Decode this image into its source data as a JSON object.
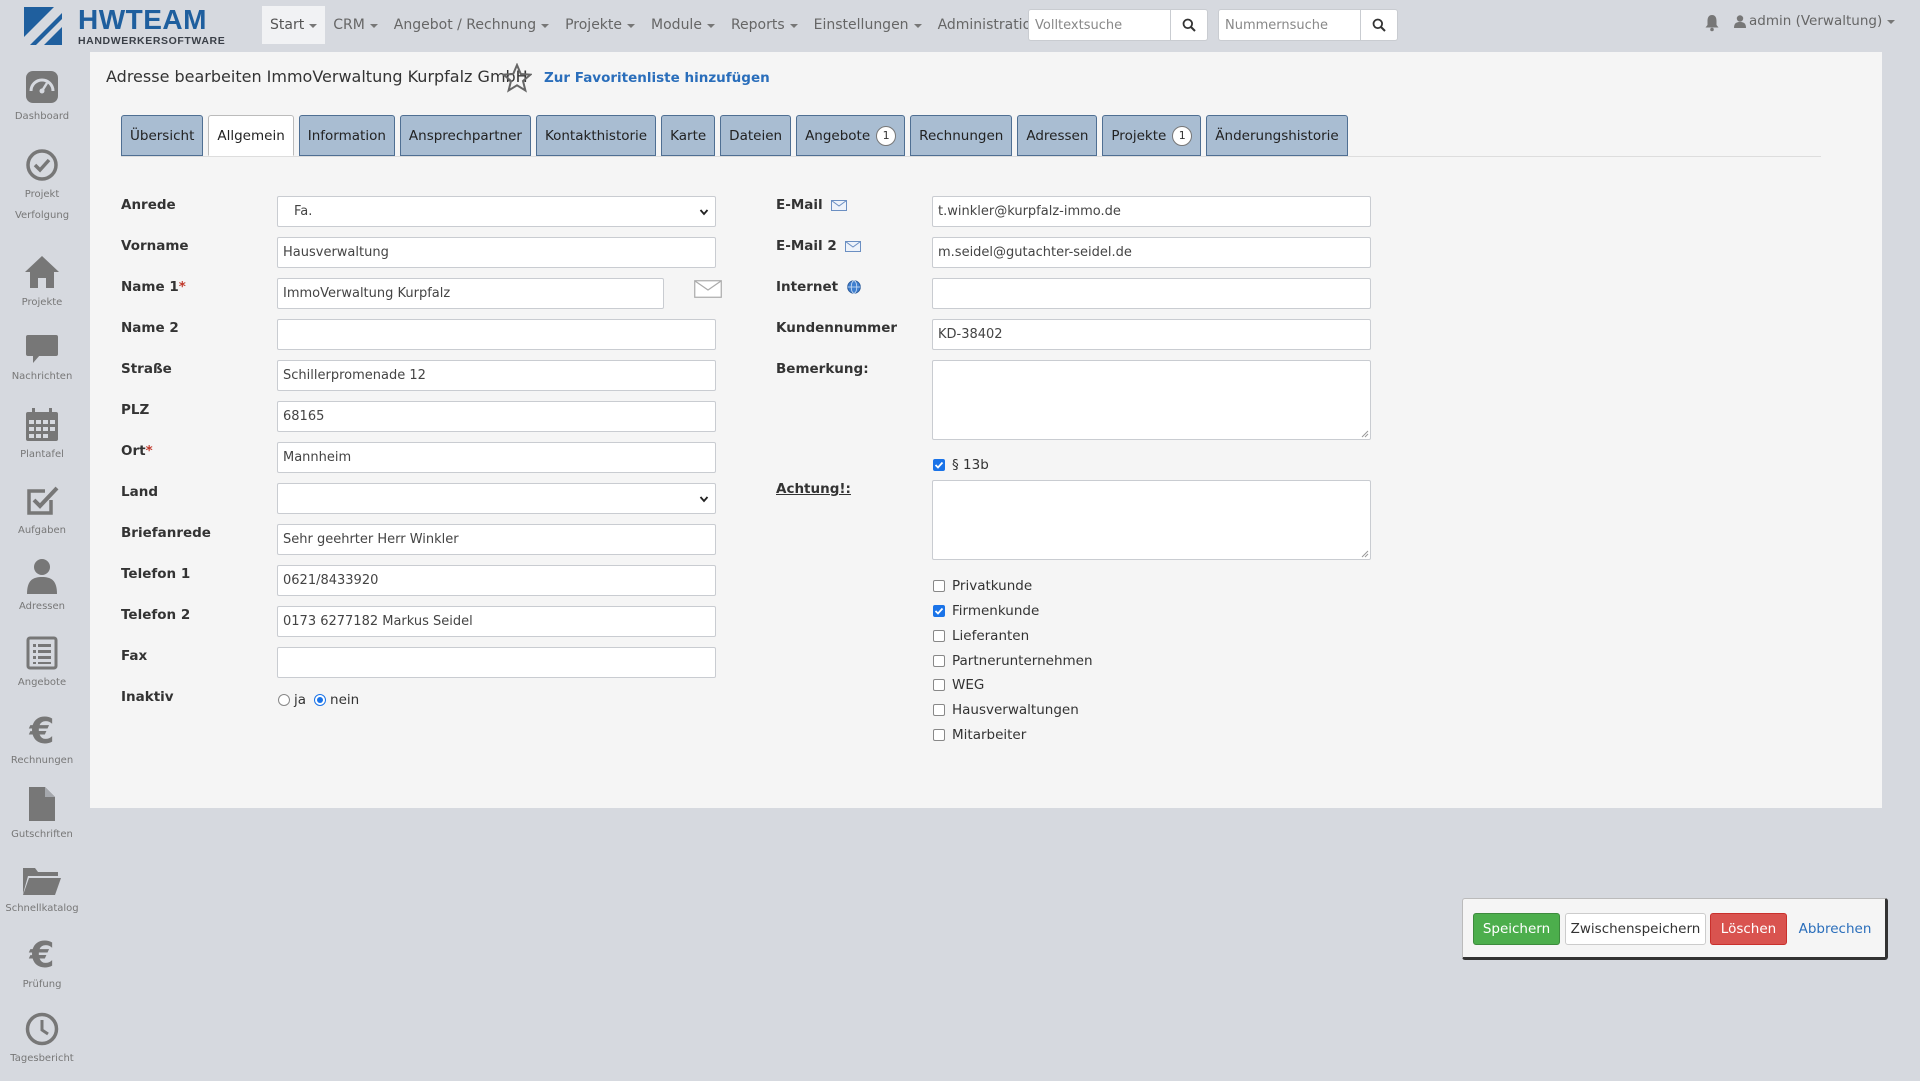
{
  "brand": {
    "title": "HWTEAM",
    "subtitle": "HANDWERKERSOFTWARE"
  },
  "menu": [
    {
      "label": "Start",
      "active": true
    },
    {
      "label": "CRM"
    },
    {
      "label": "Angebot / Rechnung"
    },
    {
      "label": "Projekte"
    },
    {
      "label": "Module"
    },
    {
      "label": "Reports"
    },
    {
      "label": "Einstellungen"
    },
    {
      "label": "Administration"
    }
  ],
  "search": {
    "fulltext_placeholder": "Volltextsuche",
    "number_placeholder": "Nummernsuche"
  },
  "user": {
    "label": "admin (Verwaltung)"
  },
  "sidebar": [
    {
      "label": "Dashboard",
      "icon": "dashboard-icon"
    },
    {
      "label": "Projekt Verfolgung",
      "icon": "check-circle-icon"
    },
    {
      "label": "Projekte",
      "icon": "home-icon"
    },
    {
      "label": "Nachrichten",
      "icon": "chat-icon"
    },
    {
      "label": "Plantafel",
      "icon": "calendar-icon"
    },
    {
      "label": "Aufgaben",
      "icon": "check-square-icon"
    },
    {
      "label": "Adressen",
      "icon": "user-icon"
    },
    {
      "label": "Angebote",
      "icon": "list-icon"
    },
    {
      "label": "Rechnungen",
      "icon": "euro-icon"
    },
    {
      "label": "Gutschriften",
      "icon": "file-icon"
    },
    {
      "label": "Schnellkatalog",
      "icon": "folder-open-icon"
    },
    {
      "label": "Prüfung",
      "icon": "euro-icon"
    },
    {
      "label": "Tagesbericht",
      "icon": "clock-icon"
    }
  ],
  "page": {
    "title": "Adresse bearbeiten ImmoVerwaltung Kurpfalz GmbH",
    "favorite_link": "Zur Favoritenliste hinzufügen"
  },
  "tabs": [
    {
      "label": "Übersicht"
    },
    {
      "label": "Allgemein",
      "active": true
    },
    {
      "label": "Information"
    },
    {
      "label": "Ansprechpartner"
    },
    {
      "label": "Kontakthistorie"
    },
    {
      "label": "Karte"
    },
    {
      "label": "Dateien"
    },
    {
      "label": "Angebote",
      "badge": "1"
    },
    {
      "label": "Rechnungen"
    },
    {
      "label": "Adressen"
    },
    {
      "label": "Projekte",
      "badge": "1"
    },
    {
      "label": "Änderungshistorie"
    }
  ],
  "form_left": {
    "anrede": {
      "label": "Anrede",
      "value": "Fa."
    },
    "vorname": {
      "label": "Vorname",
      "value": "Hausverwaltung"
    },
    "name1": {
      "label": "Name 1",
      "required": "*",
      "value": "ImmoVerwaltung Kurpfalz"
    },
    "name2": {
      "label": "Name 2",
      "value": ""
    },
    "strasse": {
      "label": "Straße",
      "value": "Schillerpromenade 12"
    },
    "plz": {
      "label": "PLZ",
      "value": "68165"
    },
    "ort": {
      "label": "Ort",
      "required": "*",
      "value": "Mannheim"
    },
    "land": {
      "label": "Land",
      "value": ""
    },
    "briefanrede": {
      "label": "Briefanrede",
      "value": "Sehr geehrter Herr Winkler"
    },
    "telefon1": {
      "label": "Telefon 1",
      "value": "0621/8433920"
    },
    "telefon2": {
      "label": "Telefon 2",
      "value": "0173 6277182 Markus Seidel"
    },
    "fax": {
      "label": "Fax",
      "value": ""
    },
    "inaktiv": {
      "label": "Inaktiv",
      "options": [
        "ja",
        "nein"
      ],
      "selected": "nein"
    }
  },
  "form_right": {
    "email": {
      "label": "E-Mail",
      "value": "t.winkler@kurpfalz-immo.de"
    },
    "email2": {
      "label": "E-Mail 2",
      "value": "m.seidel@gutachter-seidel.de"
    },
    "internet": {
      "label": "Internet",
      "value": ""
    },
    "kundennummer": {
      "label": "Kundennummer",
      "value": "KD-38402"
    },
    "bemerkung": {
      "label": "Bemerkung:",
      "value": ""
    },
    "p13b": {
      "label": "§ 13b",
      "checked": true
    },
    "achtung": {
      "label": "Achtung!:",
      "value": ""
    },
    "checkboxes": [
      {
        "label": "Privatkunde",
        "checked": false
      },
      {
        "label": "Firmenkunde",
        "checked": true
      },
      {
        "label": "Lieferanten",
        "checked": false
      },
      {
        "label": "Partnerunternehmen",
        "checked": false
      },
      {
        "label": "WEG",
        "checked": false
      },
      {
        "label": "Hausverwaltungen",
        "checked": false
      },
      {
        "label": "Mitarbeiter",
        "checked": false
      }
    ]
  },
  "actions": {
    "save": "Speichern",
    "intermediate_save": "Zwischenspeichern",
    "delete": "Löschen",
    "cancel": "Abbrechen"
  },
  "colors": {
    "brand": "#1f5f9e",
    "tab": "#a9bdd2",
    "save": "#4cae4c",
    "delete": "#d9534f",
    "link": "#2a6ebb"
  }
}
